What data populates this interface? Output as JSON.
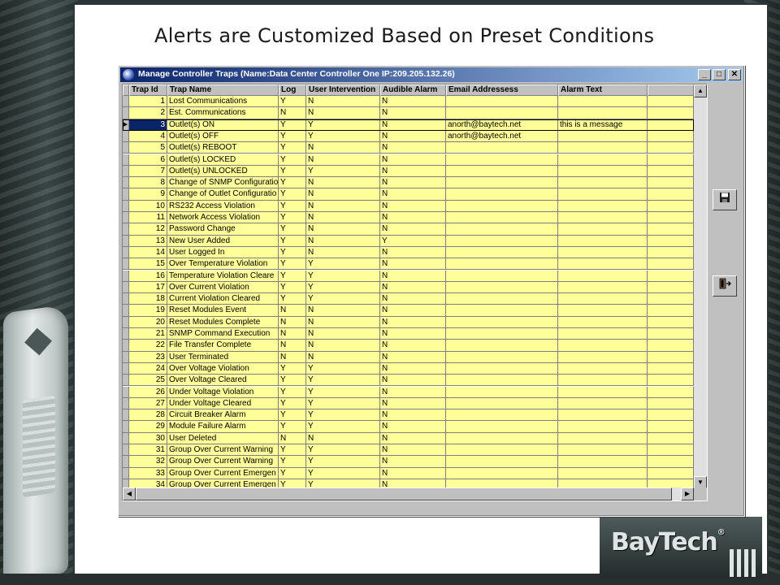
{
  "slide": {
    "title": "Alerts are Customized Based on Preset Conditions",
    "logo": "BayTech",
    "logo_mark": "®"
  },
  "window": {
    "title": "Manage Controller Traps (Name:Data Center Controller One IP:209.205.132.26)",
    "min_label": "_",
    "max_label": "□",
    "close_label": "✕"
  },
  "grid": {
    "columns": [
      "Trap Id",
      "Trap Name",
      "Log",
      "User Intervention",
      "Audible Alarm",
      "Email Addressess",
      "Alarm Text"
    ],
    "current_row": 3,
    "rows": [
      {
        "id": "1",
        "name": "Lost Communications",
        "log": "Y",
        "intervention": "N",
        "audible": "N",
        "email": "",
        "text": ""
      },
      {
        "id": "2",
        "name": "Est. Communications",
        "log": "N",
        "intervention": "N",
        "audible": "N",
        "email": "",
        "text": ""
      },
      {
        "id": "3",
        "name": "Outlet(s) ON",
        "log": "Y",
        "intervention": "Y",
        "audible": "N",
        "email": "anorth@baytech.net",
        "text": "this is a message"
      },
      {
        "id": "4",
        "name": "Outlet(s) OFF",
        "log": "Y",
        "intervention": "Y",
        "audible": "N",
        "email": "anorth@baytech.net",
        "text": ""
      },
      {
        "id": "5",
        "name": "Outlet(s) REBOOT",
        "log": "Y",
        "intervention": "N",
        "audible": "N",
        "email": "",
        "text": ""
      },
      {
        "id": "6",
        "name": "Outlet(s) LOCKED",
        "log": "Y",
        "intervention": "N",
        "audible": "N",
        "email": "",
        "text": ""
      },
      {
        "id": "7",
        "name": "Outlet(s) UNLOCKED",
        "log": "Y",
        "intervention": "Y",
        "audible": "N",
        "email": "",
        "text": ""
      },
      {
        "id": "8",
        "name": "Change of SNMP Configuratio",
        "log": "Y",
        "intervention": "N",
        "audible": "N",
        "email": "",
        "text": ""
      },
      {
        "id": "9",
        "name": "Change of Outlet Configuratio",
        "log": "Y",
        "intervention": "N",
        "audible": "N",
        "email": "",
        "text": ""
      },
      {
        "id": "10",
        "name": "RS232 Access Violation",
        "log": "Y",
        "intervention": "N",
        "audible": "N",
        "email": "",
        "text": ""
      },
      {
        "id": "11",
        "name": "Network Access Violation",
        "log": "Y",
        "intervention": "N",
        "audible": "N",
        "email": "",
        "text": ""
      },
      {
        "id": "12",
        "name": "Password Change",
        "log": "Y",
        "intervention": "N",
        "audible": "N",
        "email": "",
        "text": ""
      },
      {
        "id": "13",
        "name": "New User Added",
        "log": "Y",
        "intervention": "N",
        "audible": "Y",
        "email": "",
        "text": ""
      },
      {
        "id": "14",
        "name": "User Logged In",
        "log": "Y",
        "intervention": "N",
        "audible": "N",
        "email": "",
        "text": ""
      },
      {
        "id": "15",
        "name": "Over Temperature Violation",
        "log": "Y",
        "intervention": "Y",
        "audible": "N",
        "email": "",
        "text": ""
      },
      {
        "id": "16",
        "name": "Temperature Violation Cleare",
        "log": "Y",
        "intervention": "Y",
        "audible": "N",
        "email": "",
        "text": ""
      },
      {
        "id": "17",
        "name": "Over Current Violation",
        "log": "Y",
        "intervention": "Y",
        "audible": "N",
        "email": "",
        "text": ""
      },
      {
        "id": "18",
        "name": "Current Violation Cleared",
        "log": "Y",
        "intervention": "Y",
        "audible": "N",
        "email": "",
        "text": ""
      },
      {
        "id": "19",
        "name": "Reset Modules Event",
        "log": "N",
        "intervention": "N",
        "audible": "N",
        "email": "",
        "text": ""
      },
      {
        "id": "20",
        "name": "Reset Modules Complete",
        "log": "N",
        "intervention": "N",
        "audible": "N",
        "email": "",
        "text": ""
      },
      {
        "id": "21",
        "name": "SNMP Command Execution",
        "log": "N",
        "intervention": "N",
        "audible": "N",
        "email": "",
        "text": ""
      },
      {
        "id": "22",
        "name": "File Transfer Complete",
        "log": "N",
        "intervention": "N",
        "audible": "N",
        "email": "",
        "text": ""
      },
      {
        "id": "23",
        "name": "User Terminated",
        "log": "N",
        "intervention": "N",
        "audible": "N",
        "email": "",
        "text": ""
      },
      {
        "id": "24",
        "name": "Over Voltage Violation",
        "log": "Y",
        "intervention": "Y",
        "audible": "N",
        "email": "",
        "text": ""
      },
      {
        "id": "25",
        "name": "Over Voltage Cleared",
        "log": "Y",
        "intervention": "Y",
        "audible": "N",
        "email": "",
        "text": ""
      },
      {
        "id": "26",
        "name": "Under Voltage Violation",
        "log": "Y",
        "intervention": "Y",
        "audible": "N",
        "email": "",
        "text": ""
      },
      {
        "id": "27",
        "name": "Under Voltage Cleared",
        "log": "Y",
        "intervention": "Y",
        "audible": "N",
        "email": "",
        "text": ""
      },
      {
        "id": "28",
        "name": "Circuit Breaker Alarm",
        "log": "Y",
        "intervention": "Y",
        "audible": "N",
        "email": "",
        "text": ""
      },
      {
        "id": "29",
        "name": "Module Failure Alarm",
        "log": "Y",
        "intervention": "Y",
        "audible": "N",
        "email": "",
        "text": ""
      },
      {
        "id": "30",
        "name": "User Deleted",
        "log": "N",
        "intervention": "N",
        "audible": "N",
        "email": "",
        "text": ""
      },
      {
        "id": "31",
        "name": "Group Over Current Warning",
        "log": "Y",
        "intervention": "Y",
        "audible": "N",
        "email": "",
        "text": ""
      },
      {
        "id": "32",
        "name": "Group Over Current Warning",
        "log": "Y",
        "intervention": "Y",
        "audible": "N",
        "email": "",
        "text": ""
      },
      {
        "id": "33",
        "name": "Group Over Current Emergen",
        "log": "Y",
        "intervention": "Y",
        "audible": "N",
        "email": "",
        "text": ""
      },
      {
        "id": "34",
        "name": "Group Over Current Emergen",
        "log": "Y",
        "intervention": "Y",
        "audible": "N",
        "email": "",
        "text": ""
      }
    ]
  },
  "icons": {
    "save": "floppy-disk-icon",
    "exit": "exit-door-icon"
  }
}
